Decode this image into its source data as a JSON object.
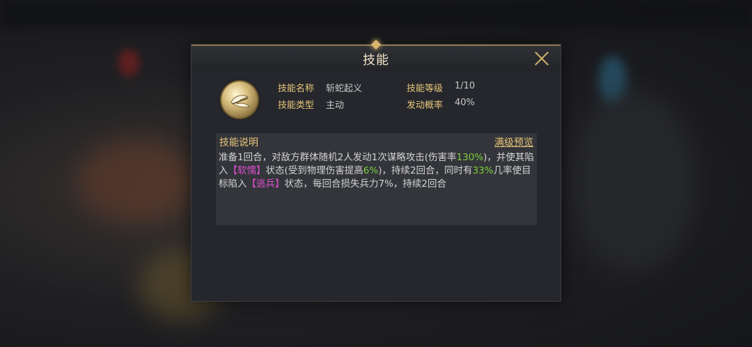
{
  "dialog": {
    "title": "技能",
    "close_icon": "close-icon",
    "skill_icon": "snake-slash-skill-icon"
  },
  "skill_info": {
    "name_label": "技能名称",
    "name_value": "斩蛇起义",
    "level_label": "技能等级",
    "level_value": "1/10",
    "type_label": "技能类型",
    "type_value": "主动",
    "chance_label": "发动概率",
    "chance_value": "40%"
  },
  "description": {
    "title": "技能说明",
    "max_preview_label": "满级预览",
    "segments": [
      {
        "text": "准备1回合，对敌方群体随机2人发动1次谋略攻击(伤害率",
        "style": "normal"
      },
      {
        "text": "130%",
        "style": "green"
      },
      {
        "text": ")，并使其陷入",
        "style": "normal"
      },
      {
        "text": "【软懦】",
        "style": "pink"
      },
      {
        "text": "状态(受到物理伤害提高",
        "style": "normal"
      },
      {
        "text": "6%",
        "style": "green"
      },
      {
        "text": ")，持续2回合，同时有",
        "style": "normal"
      },
      {
        "text": "33%",
        "style": "green"
      },
      {
        "text": "几率使目标陷入",
        "style": "normal"
      },
      {
        "text": "【逃兵】",
        "style": "pink"
      },
      {
        "text": "状态，每回合损失兵力7%，持续2回合",
        "style": "normal"
      }
    ]
  },
  "colors": {
    "label_gold": "#e8c77a",
    "highlight_green": "#7ecf3e",
    "highlight_pink": "#e04fd0"
  }
}
